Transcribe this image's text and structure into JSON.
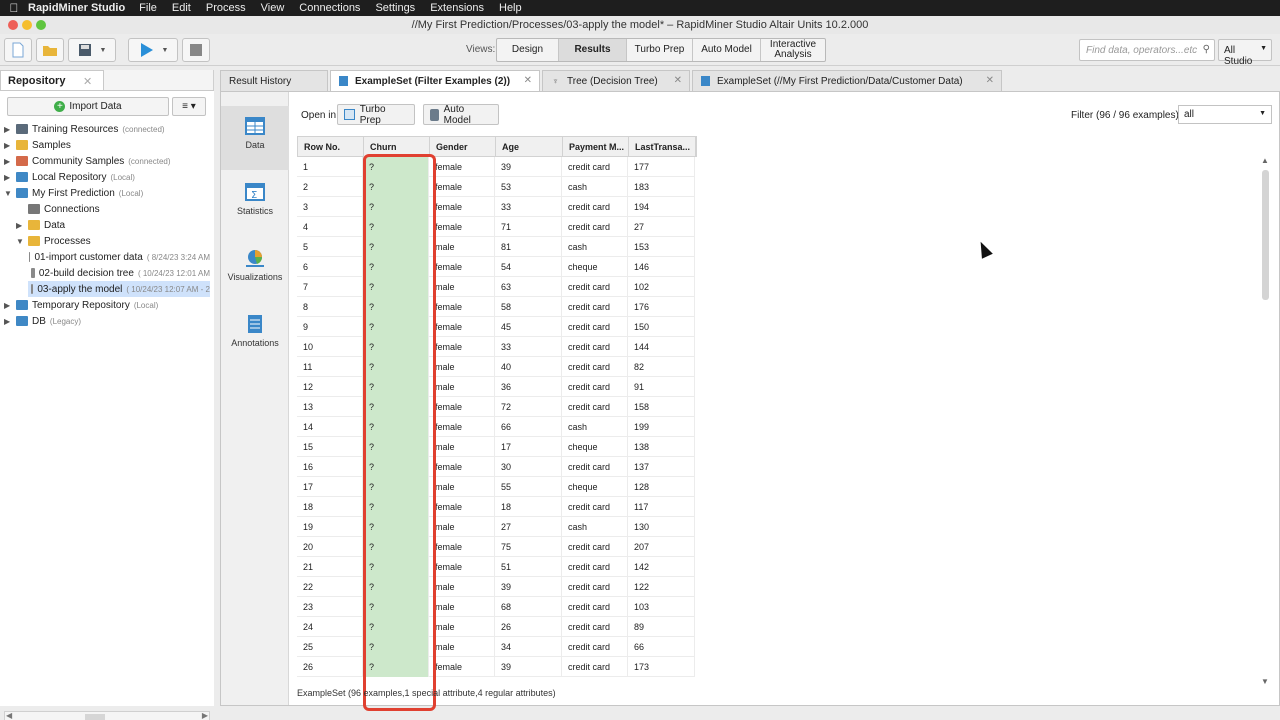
{
  "menubar": {
    "app": "RapidMiner Studio",
    "items": [
      "File",
      "Edit",
      "Process",
      "View",
      "Connections",
      "Settings",
      "Extensions",
      "Help"
    ]
  },
  "window": {
    "title": "//My First Prediction/Processes/03-apply the model* – RapidMiner Studio Altair Units 10.2.000"
  },
  "toolbar": {
    "views_label": "Views:",
    "views": [
      {
        "label": "Design",
        "active": false
      },
      {
        "label": "Results",
        "active": true
      },
      {
        "label": "Turbo Prep",
        "active": false
      },
      {
        "label": "Auto Model",
        "active": false
      },
      {
        "label": "Interactive Analysis",
        "active": false
      }
    ],
    "search_placeholder": "Find data, operators...etc",
    "studio_select": "All Studio"
  },
  "repository": {
    "tab_label": "Repository",
    "import_label": "Import Data",
    "tree": [
      {
        "label": "Training Resources",
        "sub": "(connected)",
        "level": 0,
        "arrow": "▶",
        "icon": "server-icon",
        "color": "#5a6a7a"
      },
      {
        "label": "Samples",
        "sub": "",
        "level": 0,
        "arrow": "▶",
        "icon": "folder-icon",
        "color": "#e8b53a"
      },
      {
        "label": "Community Samples",
        "sub": "(connected)",
        "level": 0,
        "arrow": "▶",
        "icon": "community-icon",
        "color": "#d46a4a"
      },
      {
        "label": "Local Repository",
        "sub": "(Local)",
        "level": 0,
        "arrow": "▶",
        "icon": "computer-icon",
        "color": "#3f88c5"
      },
      {
        "label": "My First Prediction",
        "sub": "(Local)",
        "level": 0,
        "arrow": "▼",
        "icon": "computer-icon",
        "color": "#3f88c5"
      },
      {
        "label": "Connections",
        "sub": "",
        "level": 1,
        "arrow": "",
        "icon": "connections-icon",
        "color": "#777777"
      },
      {
        "label": "Data",
        "sub": "",
        "level": 1,
        "arrow": "▶",
        "icon": "folder-icon",
        "color": "#e8b53a"
      },
      {
        "label": "Processes",
        "sub": "",
        "level": 1,
        "arrow": "▼",
        "icon": "folder-icon",
        "color": "#e8b53a"
      },
      {
        "label": "01-import customer data",
        "sub": "( 8/24/23 3:24 AM",
        "level": 2,
        "arrow": "",
        "icon": "process-icon",
        "color": "#8a8a8a"
      },
      {
        "label": "02-build decision tree",
        "sub": "( 10/24/23 12:01 AM",
        "level": 2,
        "arrow": "",
        "icon": "process-icon",
        "color": "#8a8a8a"
      },
      {
        "label": "03-apply the model",
        "sub": "( 10/24/23 12:07 AM - 2",
        "level": 2,
        "arrow": "",
        "icon": "process-icon",
        "color": "#8a8a8a",
        "selected": true
      },
      {
        "label": "Temporary Repository",
        "sub": "(Local)",
        "level": 0,
        "arrow": "▶",
        "icon": "computer-icon",
        "color": "#3f88c5"
      },
      {
        "label": "DB",
        "sub": "(Legacy)",
        "level": 0,
        "arrow": "▶",
        "icon": "database-icon",
        "color": "#3f88c5"
      }
    ]
  },
  "results": {
    "tabs": [
      {
        "label": "Result History",
        "active": false,
        "closable": false
      },
      {
        "label": "ExampleSet (Filter Examples (2))",
        "active": true,
        "closable": true
      },
      {
        "label": "Tree (Decision Tree)",
        "active": false,
        "closable": true
      },
      {
        "label": "ExampleSet (//My First Prediction/Data/Customer Data)",
        "active": false,
        "closable": true
      }
    ],
    "sidenav": [
      "Data",
      "Statistics",
      "Visualizations",
      "Annotations"
    ],
    "open_in_label": "Open in",
    "turbo_prep_label": "Turbo Prep",
    "auto_model_label": "Auto Model",
    "filter_label": "Filter (96 / 96 examples):",
    "filter_value": "all",
    "status": "ExampleSet (96 examples,1 special attribute,4 regular attributes)"
  },
  "table": {
    "columns": [
      "Row No.",
      "Churn",
      "Gender",
      "Age",
      "Payment M...",
      "LastTransa..."
    ],
    "rows": [
      [
        "1",
        "?",
        "female",
        "39",
        "credit card",
        "177"
      ],
      [
        "2",
        "?",
        "female",
        "53",
        "cash",
        "183"
      ],
      [
        "3",
        "?",
        "female",
        "33",
        "credit card",
        "194"
      ],
      [
        "4",
        "?",
        "female",
        "71",
        "credit card",
        "27"
      ],
      [
        "5",
        "?",
        "male",
        "81",
        "cash",
        "153"
      ],
      [
        "6",
        "?",
        "female",
        "54",
        "cheque",
        "146"
      ],
      [
        "7",
        "?",
        "male",
        "63",
        "credit card",
        "102"
      ],
      [
        "8",
        "?",
        "female",
        "58",
        "credit card",
        "176"
      ],
      [
        "9",
        "?",
        "female",
        "45",
        "credit card",
        "150"
      ],
      [
        "10",
        "?",
        "female",
        "33",
        "credit card",
        "144"
      ],
      [
        "11",
        "?",
        "male",
        "40",
        "credit card",
        "82"
      ],
      [
        "12",
        "?",
        "male",
        "36",
        "credit card",
        "91"
      ],
      [
        "13",
        "?",
        "female",
        "72",
        "credit card",
        "158"
      ],
      [
        "14",
        "?",
        "female",
        "66",
        "cash",
        "199"
      ],
      [
        "15",
        "?",
        "male",
        "17",
        "cheque",
        "138"
      ],
      [
        "16",
        "?",
        "female",
        "30",
        "credit card",
        "137"
      ],
      [
        "17",
        "?",
        "male",
        "55",
        "cheque",
        "128"
      ],
      [
        "18",
        "?",
        "female",
        "18",
        "credit card",
        "117"
      ],
      [
        "19",
        "?",
        "male",
        "27",
        "cash",
        "130"
      ],
      [
        "20",
        "?",
        "female",
        "75",
        "credit card",
        "207"
      ],
      [
        "21",
        "?",
        "female",
        "51",
        "credit card",
        "142"
      ],
      [
        "22",
        "?",
        "male",
        "39",
        "credit card",
        "122"
      ],
      [
        "23",
        "?",
        "male",
        "68",
        "credit card",
        "103"
      ],
      [
        "24",
        "?",
        "male",
        "26",
        "credit card",
        "89"
      ],
      [
        "25",
        "?",
        "male",
        "34",
        "credit card",
        "66"
      ],
      [
        "26",
        "?",
        "female",
        "39",
        "credit card",
        "173"
      ]
    ]
  }
}
